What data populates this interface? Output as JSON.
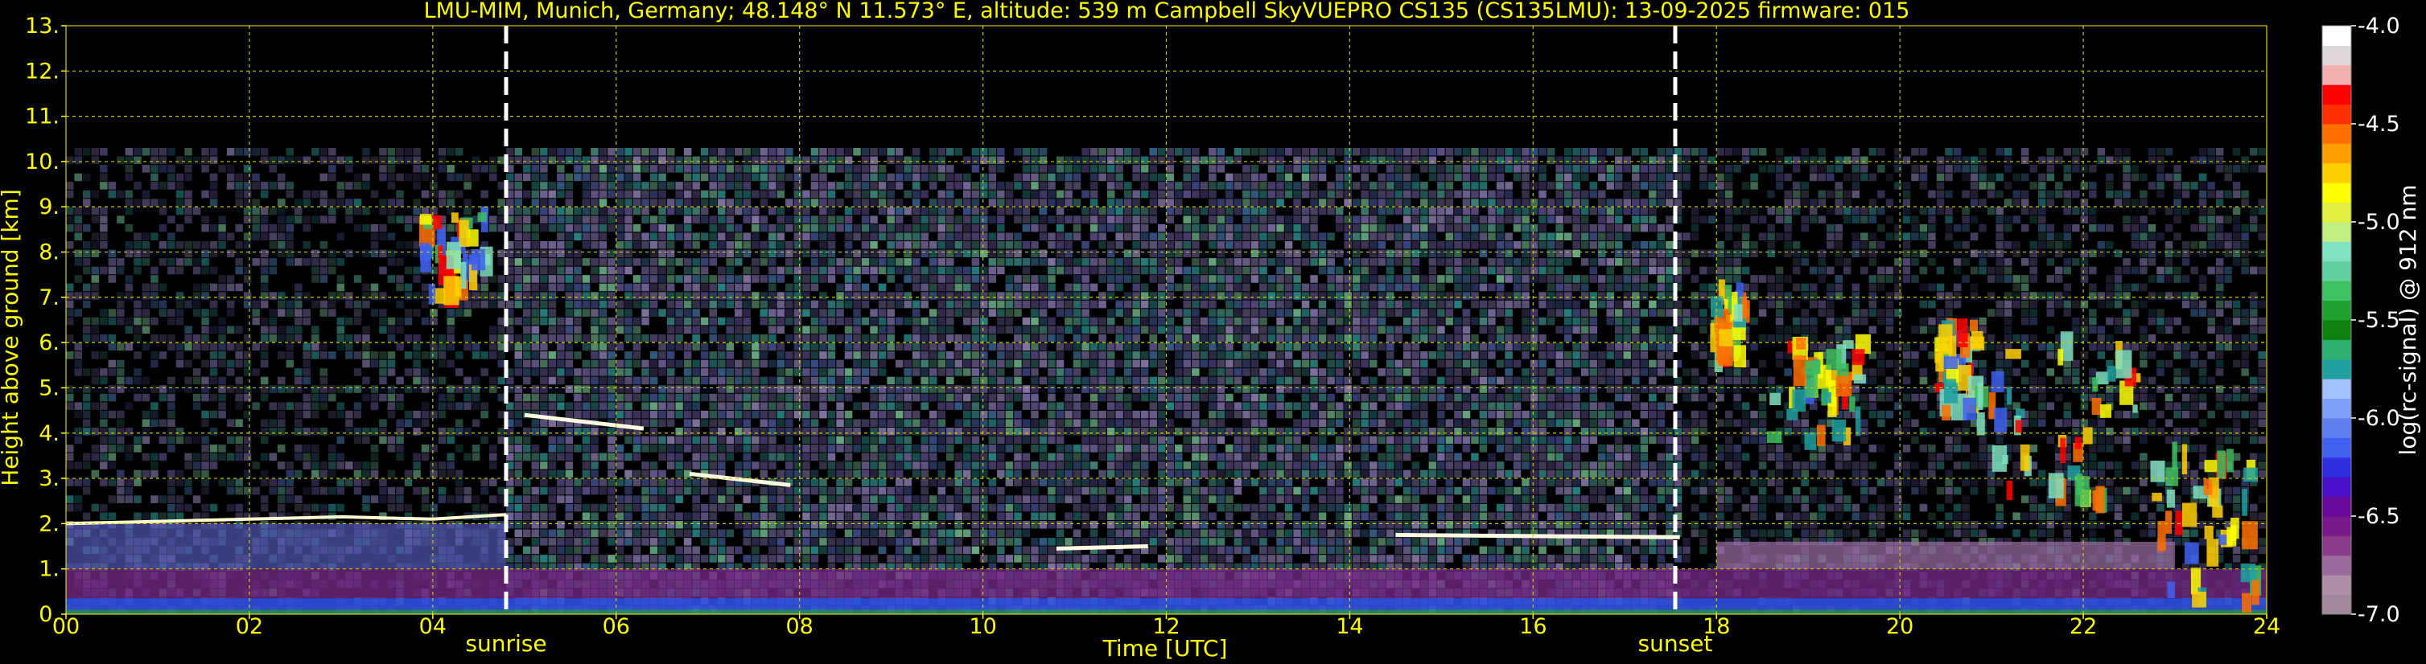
{
  "chart_data": {
    "type": "heatmap",
    "title": "LMU-MIM, Munich, Germany; 48.148° N 11.573° E, altitude: 539 m    Campbell SkyVUEPRO CS135 (CS135LMU): 13-09-2025    firmware: 015",
    "xlabel": "Time [UTC]",
    "ylabel": "Height above ground [km]",
    "xlim": [
      0,
      24
    ],
    "ylim": [
      0,
      13
    ],
    "x_ticks": [
      "00",
      "02",
      "04",
      "06",
      "08",
      "10",
      "12",
      "14",
      "16",
      "18",
      "20",
      "22",
      "24"
    ],
    "y_ticks": [
      "0.",
      "1.",
      "2.",
      "3.",
      "4.",
      "5.",
      "6.",
      "7.",
      "8.",
      "9.",
      "10.",
      "11.",
      "12.",
      "13."
    ],
    "grid": true,
    "events": [
      {
        "label": "sunrise",
        "time_h": 4.8
      },
      {
        "label": "sunset",
        "time_h": 17.55
      }
    ],
    "colorbar": {
      "label": "log(rc-signal) @ 912 nm",
      "range": [
        -7.0,
        -4.0
      ],
      "ticks": [
        "-4.0",
        "-4.5",
        "-5.0",
        "-5.5",
        "-6.0",
        "-6.5",
        "-7.0"
      ],
      "colors": [
        "#a0889a",
        "#b090a8",
        "#9a6a9a",
        "#8a3a8a",
        "#7a1a8a",
        "#6a0a9a",
        "#4a10c8",
        "#3030e0",
        "#4060f0",
        "#6080f0",
        "#80a0f8",
        "#a0c0ff",
        "#20a0a0",
        "#30b070",
        "#108010",
        "#20a030",
        "#40c060",
        "#60d0a0",
        "#80e0c0",
        "#c0f080",
        "#e0f040",
        "#ffff00",
        "#ffd000",
        "#ffa000",
        "#ff7000",
        "#ff3000",
        "#ff0000",
        "#f0b0b0",
        "#e0d8d8",
        "#ffffff"
      ]
    },
    "boundary_layer_top_km": [
      [
        0.0,
        2.0
      ],
      [
        1.0,
        2.05
      ],
      [
        2.0,
        2.1
      ],
      [
        3.0,
        2.15
      ],
      [
        4.0,
        2.1
      ],
      [
        4.8,
        2.2
      ]
    ],
    "cloud_layers": [
      {
        "x": [
          5.0,
          6.3
        ],
        "y": [
          4.4,
          4.1
        ],
        "strength": "strong"
      },
      {
        "x": [
          6.8,
          7.9
        ],
        "y": [
          3.1,
          2.85
        ],
        "strength": "strong"
      },
      {
        "x": [
          10.8,
          11.8
        ],
        "y": [
          1.45,
          1.5
        ],
        "strength": "strong"
      },
      {
        "x": [
          14.5,
          17.6
        ],
        "y": [
          1.75,
          1.7
        ],
        "strength": "strong"
      }
    ],
    "cirrus_events": [
      {
        "t_start": 3.9,
        "t_end": 4.6,
        "z_low": 7.0,
        "z_high": 8.8
      },
      {
        "t_start": 18.0,
        "t_end": 18.3,
        "z_low": 5.5,
        "z_high": 7.2
      },
      {
        "t_start": 18.6,
        "t_end": 19.6,
        "z_low": 3.8,
        "z_high": 6.0
      },
      {
        "t_start": 20.4,
        "t_end": 20.9,
        "z_low": 4.2,
        "z_high": 6.4
      },
      {
        "t_start": 21.0,
        "t_end": 22.6,
        "z_low": 2.5,
        "z_high": 6.0
      },
      {
        "t_start": 22.8,
        "t_end": 23.9,
        "z_low": 0.1,
        "z_high": 3.5
      }
    ]
  }
}
